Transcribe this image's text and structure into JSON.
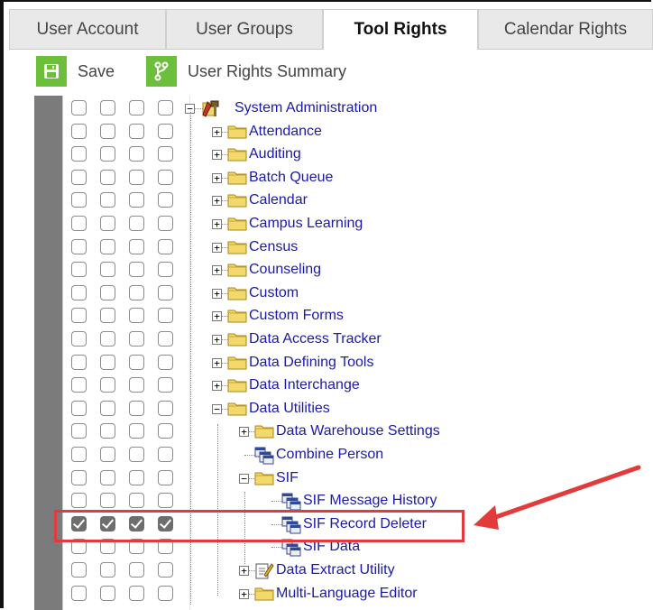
{
  "tabs": [
    {
      "label": "User Account",
      "active": false
    },
    {
      "label": "User Groups",
      "active": false
    },
    {
      "label": "Tool Rights",
      "active": true
    },
    {
      "label": "Calendar Rights",
      "active": false
    }
  ],
  "toolbar": {
    "save_label": "Save",
    "summary_label": "User Rights Summary"
  },
  "colors": {
    "accent_green": "#6cbf3a",
    "link_blue": "#1a1aa8",
    "highlight_red": "#e23b3b",
    "rail_gray": "#7b7b7b"
  },
  "tree": [
    {
      "label": "System Administration",
      "icon": "tools-icon",
      "expander": "minus",
      "checked": [
        false,
        false,
        false,
        false
      ]
    },
    {
      "label": "Attendance",
      "icon": "folder-icon",
      "expander": "plus",
      "checked": [
        false,
        false,
        false,
        false
      ]
    },
    {
      "label": "Auditing",
      "icon": "folder-icon",
      "expander": "plus",
      "checked": [
        false,
        false,
        false,
        false
      ]
    },
    {
      "label": "Batch Queue",
      "icon": "folder-icon",
      "expander": "plus",
      "checked": [
        false,
        false,
        false,
        false
      ]
    },
    {
      "label": "Calendar",
      "icon": "folder-icon",
      "expander": "plus",
      "checked": [
        false,
        false,
        false,
        false
      ]
    },
    {
      "label": "Campus Learning",
      "icon": "folder-icon",
      "expander": "plus",
      "checked": [
        false,
        false,
        false,
        false
      ]
    },
    {
      "label": "Census",
      "icon": "folder-icon",
      "expander": "plus",
      "checked": [
        false,
        false,
        false,
        false
      ]
    },
    {
      "label": "Counseling",
      "icon": "folder-icon",
      "expander": "plus",
      "checked": [
        false,
        false,
        false,
        false
      ]
    },
    {
      "label": "Custom",
      "icon": "folder-icon",
      "expander": "plus",
      "checked": [
        false,
        false,
        false,
        false
      ]
    },
    {
      "label": "Custom Forms",
      "icon": "folder-icon",
      "expander": "plus",
      "checked": [
        false,
        false,
        false,
        false
      ]
    },
    {
      "label": "Data Access Tracker",
      "icon": "folder-icon",
      "expander": "plus",
      "checked": [
        false,
        false,
        false,
        false
      ]
    },
    {
      "label": "Data Defining Tools",
      "icon": "folder-icon",
      "expander": "plus",
      "checked": [
        false,
        false,
        false,
        false
      ]
    },
    {
      "label": "Data Interchange",
      "icon": "folder-icon",
      "expander": "plus",
      "checked": [
        false,
        false,
        false,
        false
      ]
    },
    {
      "label": "Data Utilities",
      "icon": "folder-icon",
      "expander": "minus",
      "checked": [
        false,
        false,
        false,
        false
      ]
    },
    {
      "label": "Data Warehouse Settings",
      "icon": "folder-icon",
      "expander": "plus",
      "checked": [
        false,
        false,
        false,
        false
      ]
    },
    {
      "label": "Combine Person",
      "icon": "tool-page-icon",
      "expander": "none",
      "checked": [
        false,
        false,
        false,
        false
      ]
    },
    {
      "label": "SIF",
      "icon": "folder-icon",
      "expander": "minus",
      "checked": [
        false,
        false,
        false,
        false
      ]
    },
    {
      "label": "SIF Message History",
      "icon": "tool-page-icon",
      "expander": "none",
      "checked": [
        false,
        false,
        false,
        false
      ]
    },
    {
      "label": "SIF Record Deleter",
      "icon": "tool-page-icon",
      "expander": "none",
      "checked": [
        true,
        true,
        true,
        true
      ]
    },
    {
      "label": "SIF Data",
      "icon": "tool-page-icon",
      "expander": "none",
      "checked": [
        false,
        false,
        false,
        false
      ]
    },
    {
      "label": "Data Extract Utility",
      "icon": "edit-page-icon",
      "expander": "plus",
      "checked": [
        false,
        false,
        false,
        false
      ]
    },
    {
      "label": "Multi-Language Editor",
      "icon": "folder-icon",
      "expander": "plus",
      "checked": [
        false,
        false,
        false,
        false
      ]
    }
  ]
}
